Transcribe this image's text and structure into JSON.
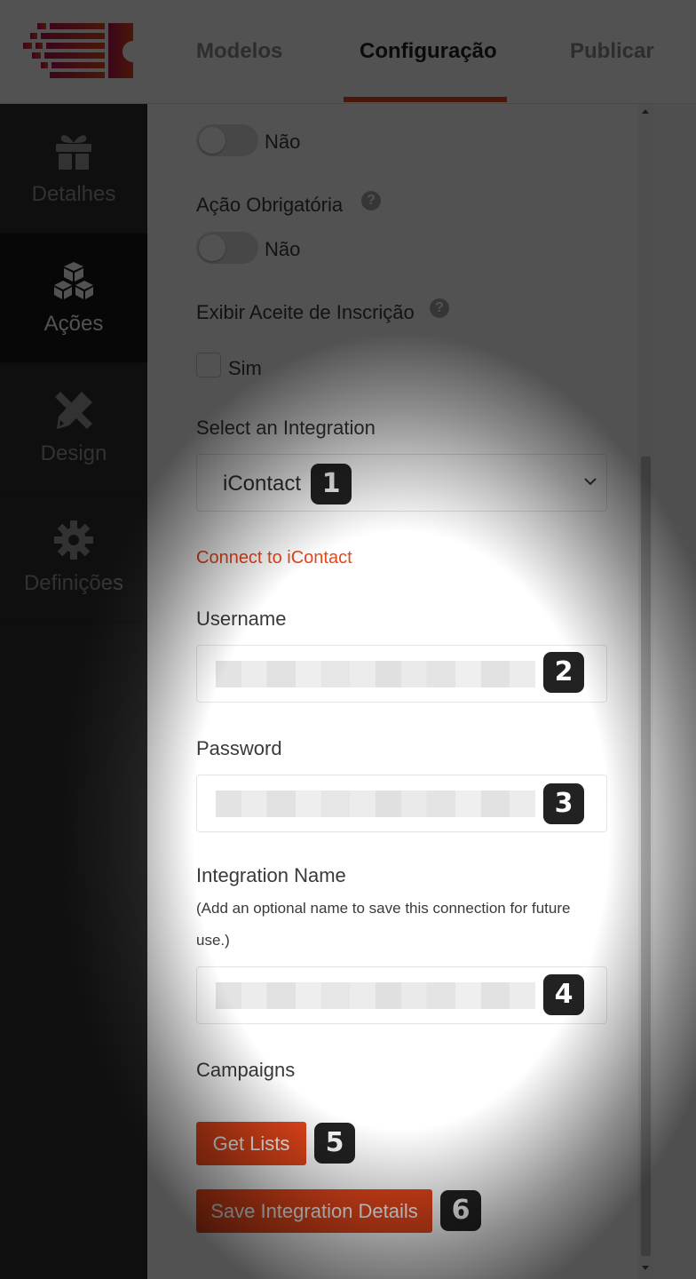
{
  "header": {
    "tabs": [
      {
        "label": "Modelos",
        "active": false
      },
      {
        "label": "Configuração",
        "active": true
      },
      {
        "label": "Publicar",
        "active": false
      }
    ]
  },
  "sidebar": {
    "items": [
      {
        "label": "Detalhes",
        "icon": "gift-icon",
        "active": false
      },
      {
        "label": "Ações",
        "icon": "cubes-icon",
        "active": true
      },
      {
        "label": "Design",
        "icon": "pencil-ruler-icon",
        "active": false
      },
      {
        "label": "Definições",
        "icon": "gear-icon",
        "active": false
      }
    ]
  },
  "form": {
    "first_toggle_value": "Não",
    "required_action": {
      "label": "Ação Obrigatória",
      "value": "Não"
    },
    "optin": {
      "label": "Exibir Aceite de Inscrição",
      "checkbox_label": "Sim"
    },
    "integration_select": {
      "label": "Select an Integration",
      "value": "iContact"
    },
    "connect_link": "Connect to iContact",
    "username_label": "Username",
    "password_label": "Password",
    "integration_name": {
      "label": "Integration Name",
      "help_text": "(Add an optional name to save this connection for future",
      "help_text_2": "use.)"
    },
    "campaigns_label": "Campaigns",
    "get_lists_button": "Get Lists",
    "save_button": "Save Integration Details"
  },
  "steps": [
    "1",
    "2",
    "3",
    "4",
    "5",
    "6"
  ],
  "colors": {
    "accent": "#e6461a",
    "sidebar_bg": "#2e2e2e",
    "badge_bg": "#222222"
  }
}
